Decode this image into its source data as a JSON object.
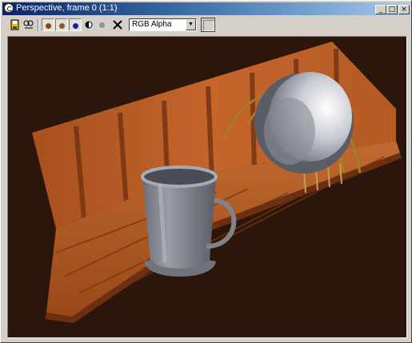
{
  "window": {
    "title": "Perspective, frame 0 (1:1)",
    "controls": {
      "minimize": "_",
      "maximize": "□",
      "close": "×"
    }
  },
  "toolbar": {
    "buttons": [
      {
        "name": "save-image-icon"
      },
      {
        "name": "clone-window-icon"
      },
      {
        "name": "red-channel-icon",
        "color": "#8b4513"
      },
      {
        "name": "green-channel-icon",
        "color": "#8b5a2b"
      },
      {
        "name": "blue-channel-icon",
        "color": "#1020c0"
      },
      {
        "name": "alpha-channel-icon"
      },
      {
        "name": "monochrome-icon",
        "color": "#909090"
      },
      {
        "name": "clear-icon"
      }
    ],
    "channel_select": {
      "value": "RGB Alpha"
    }
  },
  "viewport": {
    "background_color": "#2a160b",
    "wood_color": "#b85a26",
    "wood_dark": "#6e2e10",
    "metal_light": "#c8cad2",
    "metal_dark": "#6c6e78"
  }
}
